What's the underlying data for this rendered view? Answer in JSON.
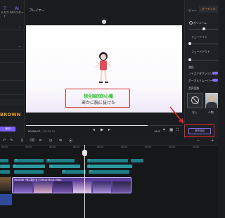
{
  "left_panel": {
    "tab_text": {
      "icon": "T",
      "label": "テキスト"
    },
    "tab_ai": {
      "icon": "AI",
      "label": "AIアバター"
    },
    "sample_text": "BROWN",
    "add_button": "追加"
  },
  "player": {
    "title": "プレイヤー",
    "subtitle_line1": "想全国回的心醫",
    "subtitle_line2": "密かに胸に抜けた",
    "time_current": "00:00:07",
    "time_total": "/ 00:03:21",
    "ratio": "16:9",
    "progress": 0.78
  },
  "right_panel": {
    "tab_view": "ビュー",
    "tab_audio": "オーディオ",
    "volume_label": "ボリューム",
    "fade_in_label": "フェードイン",
    "fade_out_label": "フェードアウト",
    "extra_label": "強化",
    "noise_label": "ノイズリダクション",
    "vocal_label": "ボーカルリムーバー",
    "voice_change_label": "音声変換",
    "tile_none_label": "なし",
    "tile_person_label": "人物",
    "apply_button": "音声強化"
  },
  "timeline": {
    "ticks": [
      "00:00",
      "00:05",
      "00:10",
      "00:15",
      "00:20",
      "00:25",
      "00:30",
      "00:35",
      "00:40"
    ],
    "video_clip_label": "YOASOBI「夜に駆ける」Official Music Video",
    "text_clip": "T"
  },
  "colors": {
    "accent": "#8a6cff",
    "highlight": "#d62828",
    "subtitle_green": "#23c323",
    "clip_teal": "#1e7f87"
  }
}
